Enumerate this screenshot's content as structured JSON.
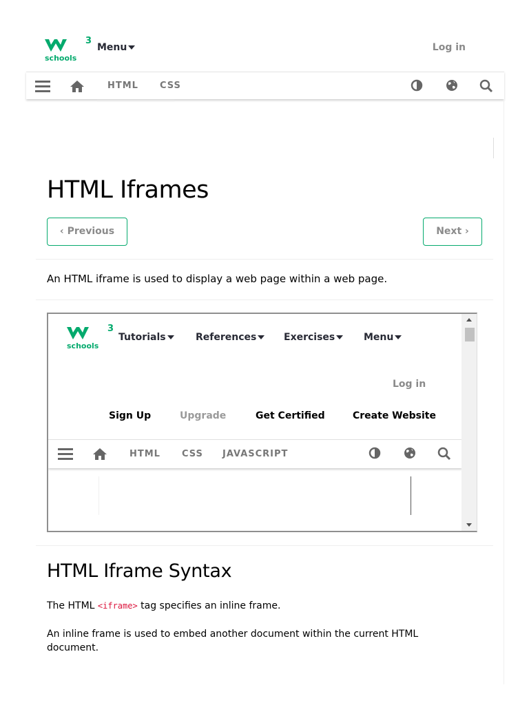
{
  "brand": {
    "sup": "3",
    "name": "schools",
    "color": "#04AA6D"
  },
  "topbar": {
    "menu_label": "Menu",
    "login_label": "Log in"
  },
  "navbar": {
    "items": [
      "HTML",
      "CSS"
    ],
    "icons": [
      "menu-icon",
      "home-icon",
      "contrast-icon",
      "globe-icon",
      "search-icon"
    ]
  },
  "page": {
    "title": "HTML Iframes",
    "prev_label": "‹ Previous",
    "next_label": "Next ›",
    "intro": "An HTML iframe is used to display a web page within a web page."
  },
  "iframe": {
    "menus": [
      "Tutorials",
      "References",
      "Exercises",
      "Menu"
    ],
    "login_label": "Log in",
    "links": [
      "Sign Up",
      "Upgrade",
      "Get Certified",
      "Create Website"
    ],
    "nav_items": [
      "HTML",
      "CSS",
      "JAVASCRIPT"
    ]
  },
  "syntax": {
    "title": "HTML Iframe Syntax",
    "p1_before": "The HTML ",
    "p1_code": "<iframe>",
    "p1_after": " tag specifies an inline frame.",
    "p2": "An inline frame is used to embed another document within the current HTML document."
  }
}
